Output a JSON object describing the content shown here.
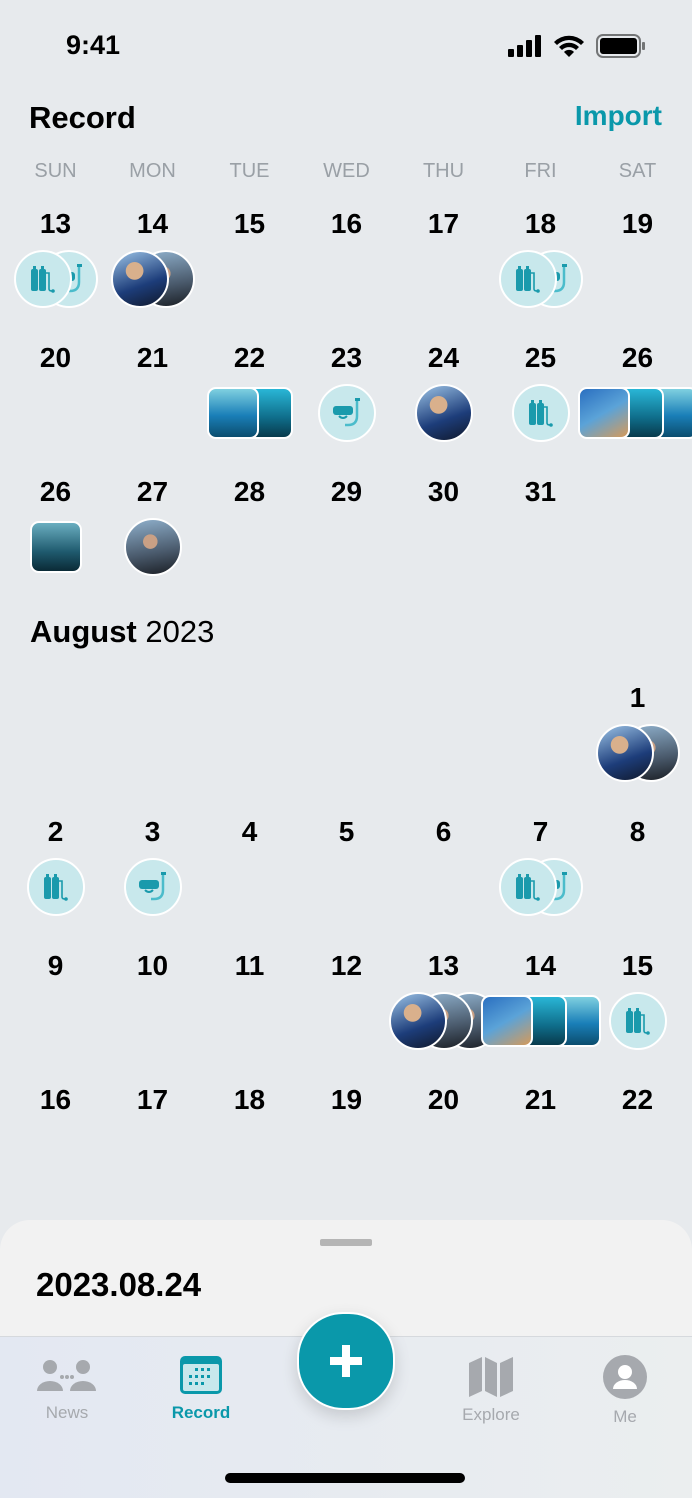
{
  "status": {
    "time": "9:41"
  },
  "header": {
    "title": "Record",
    "import_label": "Import"
  },
  "weekdays": [
    "SUN",
    "MON",
    "TUE",
    "WED",
    "THU",
    "FRI",
    "SAT"
  ],
  "accent_color": "#0a98aa",
  "july_rows": [
    [
      {
        "d": "13",
        "m": [
          "scuba",
          "snorkel"
        ]
      },
      {
        "d": "14",
        "m": [
          "p1",
          "p2"
        ]
      },
      {
        "d": "15",
        "m": []
      },
      {
        "d": "16",
        "m": []
      },
      {
        "d": "17",
        "m": []
      },
      {
        "d": "18",
        "m": [
          "scuba",
          "snorkel"
        ]
      },
      {
        "d": "19",
        "m": []
      }
    ],
    [
      {
        "d": "20",
        "m": []
      },
      {
        "d": "21",
        "m": []
      },
      {
        "d": "22",
        "m": [
          "s1",
          "s2"
        ]
      },
      {
        "d": "23",
        "m": [
          "snorkel"
        ]
      },
      {
        "d": "24",
        "m": [
          "p1"
        ]
      },
      {
        "d": "25",
        "m": [
          "scuba"
        ]
      },
      {
        "d": "26",
        "m": [
          "s3",
          "s2",
          "s1"
        ]
      }
    ],
    [
      {
        "d": "26",
        "m": [
          "s4"
        ]
      },
      {
        "d": "27",
        "m": [
          "p2"
        ]
      },
      {
        "d": "28",
        "m": []
      },
      {
        "d": "29",
        "m": []
      },
      {
        "d": "30",
        "m": []
      },
      {
        "d": "31",
        "m": []
      },
      {
        "d": "",
        "m": []
      }
    ]
  ],
  "month": {
    "name": "August",
    "year": "2023"
  },
  "august_rows": [
    [
      {
        "d": "",
        "m": []
      },
      {
        "d": "",
        "m": []
      },
      {
        "d": "",
        "m": []
      },
      {
        "d": "",
        "m": []
      },
      {
        "d": "",
        "m": []
      },
      {
        "d": "",
        "m": []
      },
      {
        "d": "1",
        "m": [
          "p1",
          "p2"
        ]
      }
    ],
    [
      {
        "d": "2",
        "m": [
          "scuba"
        ]
      },
      {
        "d": "3",
        "m": [
          "snorkel"
        ]
      },
      {
        "d": "4",
        "m": []
      },
      {
        "d": "5",
        "m": []
      },
      {
        "d": "6",
        "m": []
      },
      {
        "d": "7",
        "m": [
          "scuba",
          "snorkel"
        ]
      },
      {
        "d": "8",
        "m": []
      }
    ],
    [
      {
        "d": "9",
        "m": []
      },
      {
        "d": "10",
        "m": []
      },
      {
        "d": "11",
        "m": []
      },
      {
        "d": "12",
        "m": []
      },
      {
        "d": "13",
        "m": [
          "p1",
          "p2",
          "p2"
        ]
      },
      {
        "d": "14",
        "m": [
          "s3",
          "s2",
          "s1"
        ]
      },
      {
        "d": "15",
        "m": [
          "scuba"
        ]
      }
    ],
    [
      {
        "d": "16",
        "m": []
      },
      {
        "d": "17",
        "m": []
      },
      {
        "d": "18",
        "m": []
      },
      {
        "d": "19",
        "m": []
      },
      {
        "d": "20",
        "m": []
      },
      {
        "d": "21",
        "m": []
      },
      {
        "d": "22",
        "m": []
      }
    ]
  ],
  "sheet": {
    "selected_date": "2023.08.24"
  },
  "tabs": [
    {
      "label": "News",
      "icon": "people-icon"
    },
    {
      "label": "Record",
      "icon": "calendar-icon",
      "active": true
    },
    {
      "label": "Explore",
      "icon": "map-icon"
    },
    {
      "label": "Me",
      "icon": "user-icon"
    }
  ],
  "fab": {
    "icon": "plus-icon"
  }
}
